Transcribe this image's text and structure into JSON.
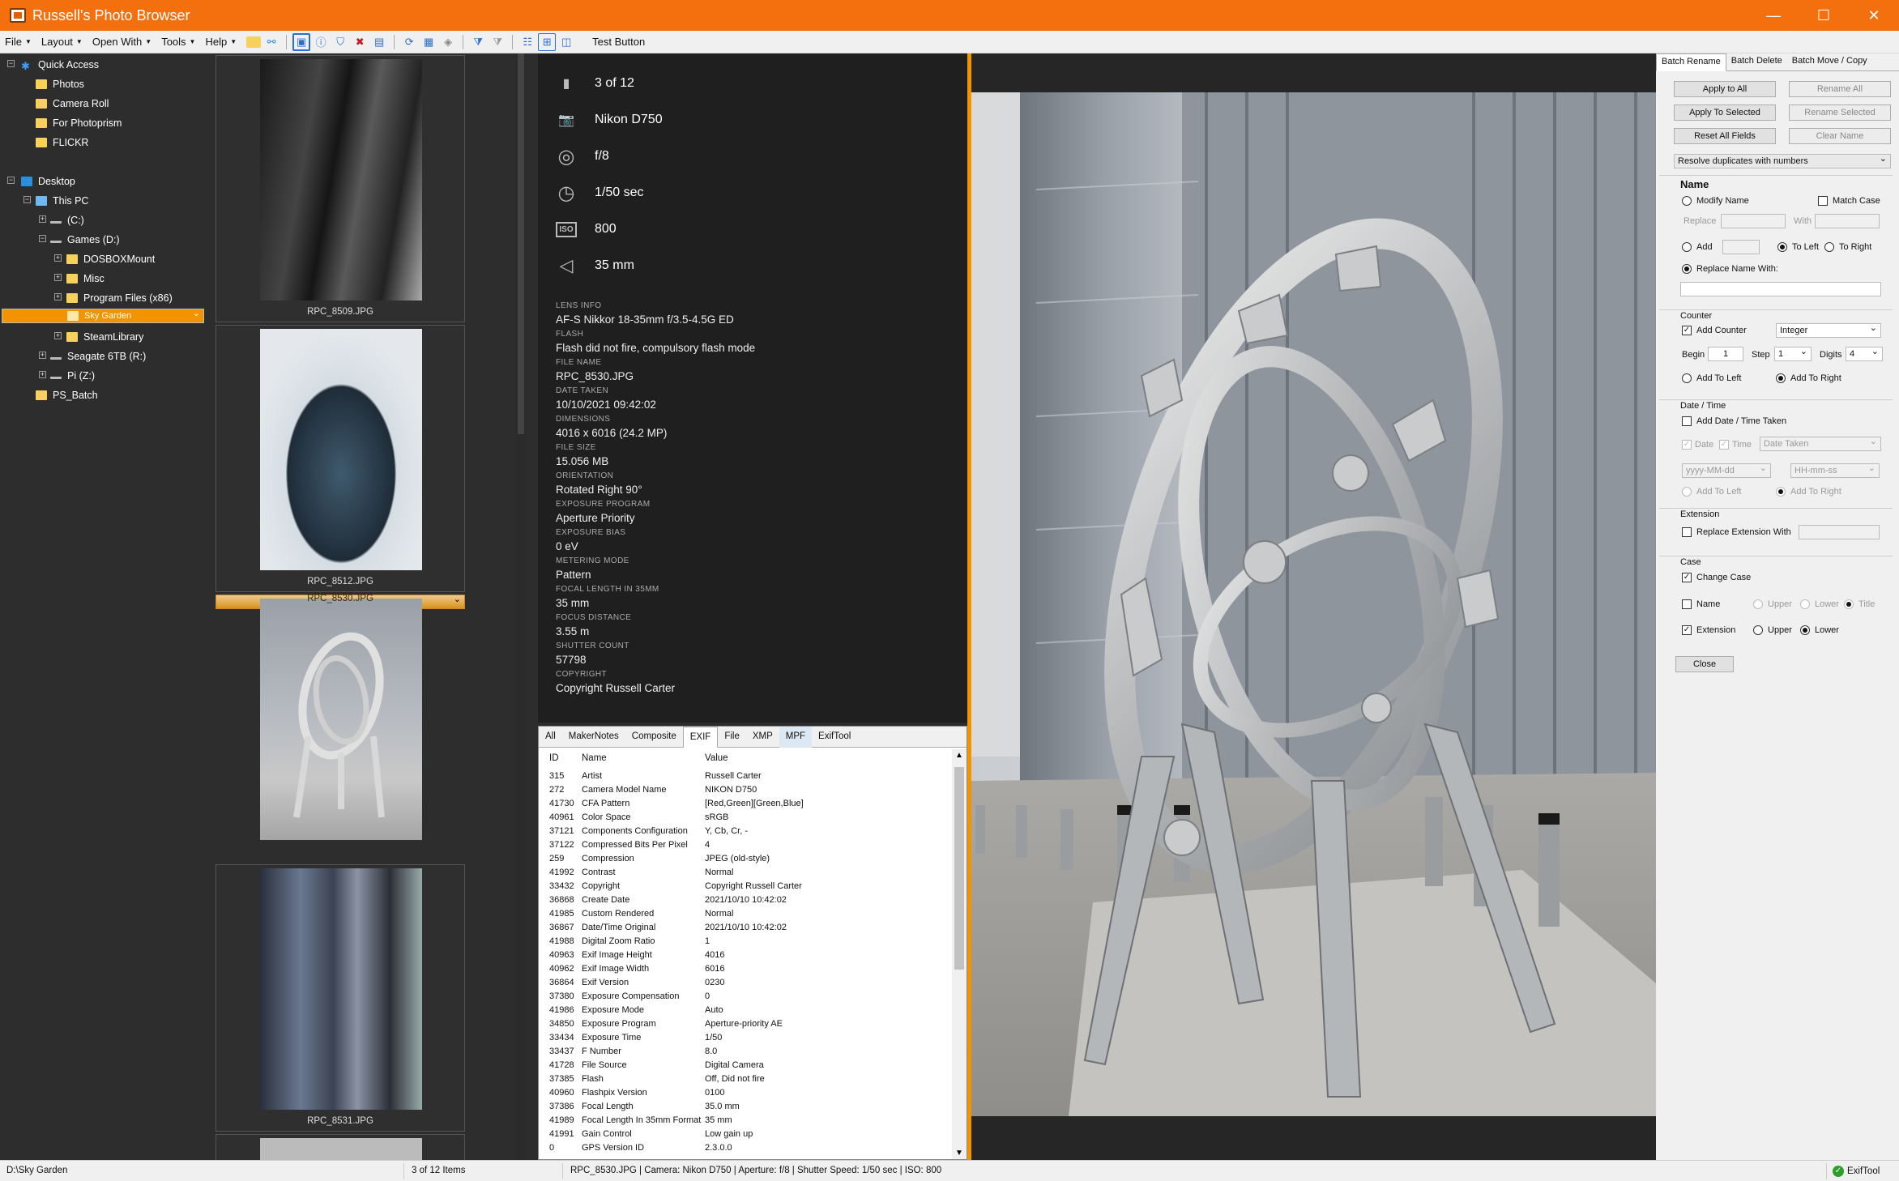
{
  "window": {
    "title": "Russell's Photo Browser",
    "minimize": "—",
    "maximize": "☐",
    "close": "✕"
  },
  "menu": [
    {
      "label": "File"
    },
    {
      "label": "Layout"
    },
    {
      "label": "Open With"
    },
    {
      "label": "Tools"
    },
    {
      "label": "Help"
    }
  ],
  "toolbar": {
    "test_button": "Test Button"
  },
  "tree": {
    "quick_access": "Quick Access",
    "photos": "Photos",
    "camera_roll": "Camera Roll",
    "for_photoprism": "For Photoprism",
    "flickr": "FLICKR",
    "desktop": "Desktop",
    "this_pc": "This PC",
    "c_drive": "(C:)",
    "games": "Games (D:)",
    "dosbox": "DOSBOXMount",
    "misc": "Misc",
    "program_files": "Program Files (x86)",
    "sky_garden": "Sky Garden",
    "steamlibrary": "SteamLibrary",
    "seagate": "Seagate 6TB (R:)",
    "pi": "Pi (Z:)",
    "ps_batch": "PS_Batch"
  },
  "thumbnails": [
    {
      "name": "RPC_8509.JPG"
    },
    {
      "name": "RPC_8512.JPG"
    },
    {
      "name": "RPC_8530.JPG"
    },
    {
      "name": "RPC_8531.JPG"
    }
  ],
  "info": {
    "position": "3 of 12",
    "camera": "Nikon D750",
    "aperture": "f/8",
    "shutter": "1/50 sec",
    "iso": "800",
    "focal": "35 mm",
    "iso_icon": "ISO"
  },
  "meta": [
    {
      "label": "LENS INFO",
      "value": "AF-S Nikkor 18-35mm f/3.5-4.5G ED"
    },
    {
      "label": "FLASH",
      "value": "Flash did not fire, compulsory flash mode"
    },
    {
      "label": "FILE NAME",
      "value": "RPC_8530.JPG"
    },
    {
      "label": "DATE TAKEN",
      "value": "10/10/2021 09:42:02"
    },
    {
      "label": "DIMENSIONS",
      "value": "4016 x 6016 (24.2 MP)"
    },
    {
      "label": "FILE SIZE",
      "value": "15.056 MB"
    },
    {
      "label": "ORIENTATION",
      "value": "Rotated Right 90°"
    },
    {
      "label": "EXPOSURE PROGRAM",
      "value": "Aperture Priority"
    },
    {
      "label": "EXPOSURE BIAS",
      "value": "0 eV"
    },
    {
      "label": "METERING MODE",
      "value": "Pattern"
    },
    {
      "label": "FOCAL LENGTH IN 35MM",
      "value": "35 mm"
    },
    {
      "label": "FOCUS DISTANCE",
      "value": "3.55 m"
    },
    {
      "label": "SHUTTER COUNT",
      "value": "57798"
    },
    {
      "label": "COPYRIGHT",
      "value": "Copyright Russell Carter"
    }
  ],
  "exif_tabs": [
    "All",
    "MakerNotes",
    "Composite",
    "EXIF",
    "File",
    "XMP",
    "MPF",
    "ExifTool"
  ],
  "exif_headers": {
    "id": "ID",
    "name": "Name",
    "value": "Value"
  },
  "exif_rows": [
    [
      "315",
      "Artist",
      "Russell Carter"
    ],
    [
      "272",
      "Camera Model Name",
      "NIKON D750"
    ],
    [
      "41730",
      "CFA Pattern",
      "[Red,Green][Green,Blue]"
    ],
    [
      "40961",
      "Color Space",
      "sRGB"
    ],
    [
      "37121",
      "Components Configuration",
      "Y, Cb, Cr, -"
    ],
    [
      "37122",
      "Compressed Bits Per Pixel",
      "4"
    ],
    [
      "259",
      "Compression",
      "JPEG (old-style)"
    ],
    [
      "41992",
      "Contrast",
      "Normal"
    ],
    [
      "33432",
      "Copyright",
      "Copyright Russell Carter"
    ],
    [
      "36868",
      "Create Date",
      "2021/10/10 10:42:02"
    ],
    [
      "41985",
      "Custom Rendered",
      "Normal"
    ],
    [
      "36867",
      "Date/Time Original",
      "2021/10/10 10:42:02"
    ],
    [
      "41988",
      "Digital Zoom Ratio",
      "1"
    ],
    [
      "40963",
      "Exif Image Height",
      "4016"
    ],
    [
      "40962",
      "Exif Image Width",
      "6016"
    ],
    [
      "36864",
      "Exif Version",
      "0230"
    ],
    [
      "37380",
      "Exposure Compensation",
      "0"
    ],
    [
      "41986",
      "Exposure Mode",
      "Auto"
    ],
    [
      "34850",
      "Exposure Program",
      "Aperture-priority AE"
    ],
    [
      "33434",
      "Exposure Time",
      "1/50"
    ],
    [
      "33437",
      "F Number",
      "8.0"
    ],
    [
      "41728",
      "File Source",
      "Digital Camera"
    ],
    [
      "37385",
      "Flash",
      "Off, Did not fire"
    ],
    [
      "40960",
      "Flashpix Version",
      "0100"
    ],
    [
      "37386",
      "Focal Length",
      "35.0 mm"
    ],
    [
      "41989",
      "Focal Length In 35mm Format",
      "35 mm"
    ],
    [
      "41991",
      "Gain Control",
      "Low gain up"
    ],
    [
      "0",
      "GPS Version ID",
      "2.3.0.0"
    ]
  ],
  "rename": {
    "tabs": [
      "Batch Rename",
      "Batch Delete",
      "Batch Move / Copy"
    ],
    "apply_all": "Apply to All",
    "rename_all": "Rename All",
    "apply_selected": "Apply To Selected",
    "rename_selected": "Rename Selected",
    "reset": "Reset All Fields",
    "clear": "Clear Name",
    "duplicates": "Resolve duplicates with numbers",
    "name_heading": "Name",
    "modify_name": "Modify Name",
    "match_case": "Match Case",
    "replace": "Replace",
    "with": "With",
    "add": "Add",
    "to_left": "To Left",
    "to_right": "To Right",
    "replace_name_with": "Replace Name With:",
    "counter": "Counter",
    "add_counter": "Add Counter",
    "integer": "Integer",
    "begin": "Begin",
    "begin_val": "1",
    "step": "Step",
    "step_val": "1",
    "digits": "Digits",
    "digits_val": "4",
    "add_to_left": "Add To Left",
    "add_to_right": "Add To Right",
    "datetime": "Date / Time",
    "add_date_taken": "Add Date / Time Taken",
    "date": "Date",
    "time": "Time",
    "date_taken": "Date Taken",
    "date_fmt": "yyyy-MM-dd",
    "time_fmt": "HH-mm-ss",
    "extension": "Extension",
    "replace_ext": "Replace Extension With",
    "case": "Case",
    "change_case": "Change Case",
    "name": "Name",
    "upper": "Upper",
    "lower": "Lower",
    "title": "Title",
    "ext": "Extension",
    "close": "Close"
  },
  "status": {
    "path": "D:\\Sky Garden",
    "count": "3 of 12 Items",
    "details": "RPC_8530.JPG  |  Camera: Nikon D750  |  Aperture: f/8  |  Shutter Speed: 1/50 sec  |  ISO: 800",
    "exiftool": "ExifTool"
  },
  "colors": {
    "accent": "#f4700f",
    "selection": "#f29400"
  }
}
